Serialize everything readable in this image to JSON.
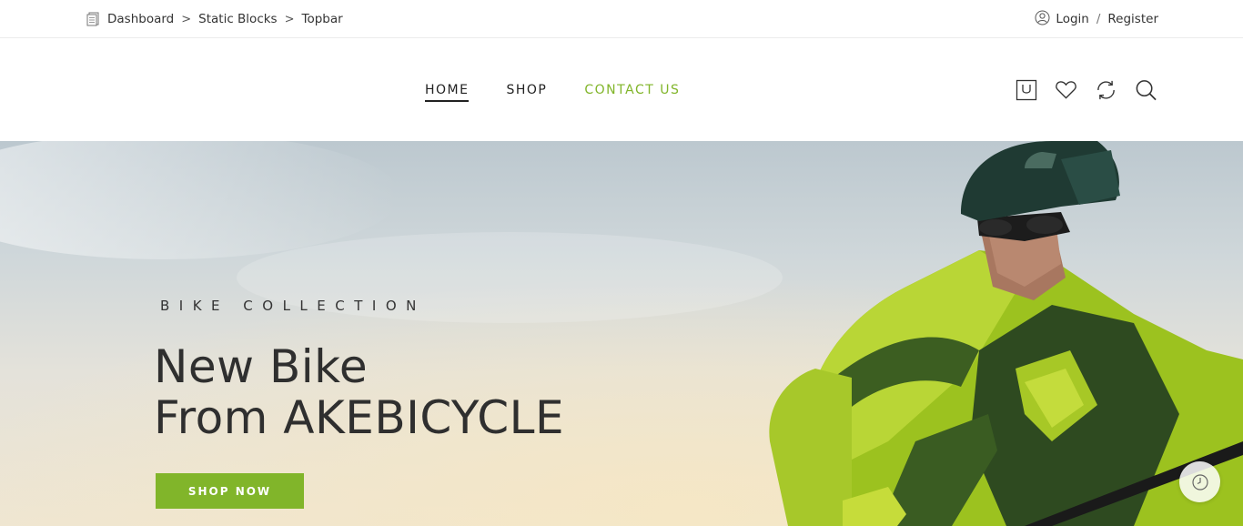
{
  "breadcrumb": {
    "icon": "document-icon",
    "items": [
      "Dashboard",
      "Static Blocks",
      "Topbar"
    ],
    "separator": ">"
  },
  "account": {
    "icon": "user-icon",
    "login": "Login",
    "separator": "/",
    "register": "Register"
  },
  "nav": {
    "items": [
      {
        "label": "HOME",
        "state": "active"
      },
      {
        "label": "SHOP",
        "state": "normal"
      },
      {
        "label": "CONTACT US",
        "state": "accent"
      }
    ]
  },
  "header_icons": [
    "cart-icon",
    "heart-icon",
    "compare-icon",
    "search-icon"
  ],
  "hero": {
    "subtitle": "BIKE COLLECTION",
    "title_line1": "New Bike",
    "title_line2": "From AKEBICYCLE",
    "button": "SHOP NOW",
    "image": "mountain-biker-photo"
  },
  "floating": {
    "icon": "clock-icon"
  },
  "colors": {
    "accent": "#81b52a",
    "text": "#2b2b2b"
  }
}
